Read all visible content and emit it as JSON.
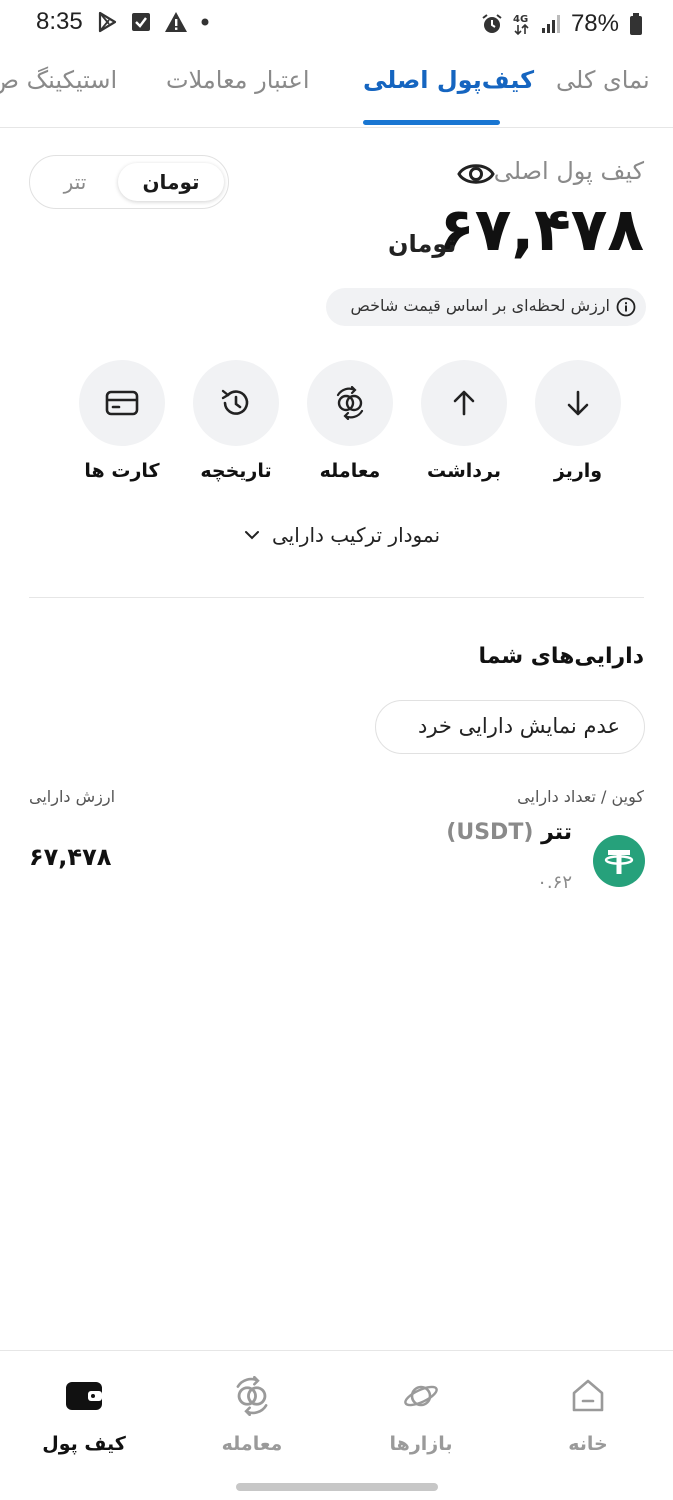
{
  "status_bar": {
    "time": "8:35",
    "battery": "78%",
    "icons": [
      "play-store-icon",
      "check-box-icon",
      "warning-icon",
      "dot-icon",
      "alarm-icon",
      "network-4g-icon",
      "signal-icon",
      "battery-icon"
    ]
  },
  "tabs": [
    {
      "label": "نمای کلی",
      "active": false
    },
    {
      "label": "کیف‌پول اصلی",
      "active": true
    },
    {
      "label": "اعتبار معاملات",
      "active": false
    },
    {
      "label": "استیکینگ ص",
      "active": false
    }
  ],
  "wallet": {
    "title": "کیف پول اصلی",
    "balance": "۶۷,۴۷۸",
    "unit": "تومان",
    "currency_toggle": {
      "selected": "تومان",
      "other": "تتر"
    },
    "info_note": "ارزش لحظه‌ای بر اساس قیمت شاخص"
  },
  "actions": [
    {
      "label": "واریز",
      "icon": "arrow-down-icon"
    },
    {
      "label": "برداشت",
      "icon": "arrow-up-icon"
    },
    {
      "label": "معامله",
      "icon": "exchange-icon"
    },
    {
      "label": "تاریخچه",
      "icon": "history-icon"
    },
    {
      "label": "کارت ها",
      "icon": "card-icon"
    }
  ],
  "chart_toggle": {
    "label": "نمودار ترکیب دارایی",
    "icon": "chevron-down-icon"
  },
  "assets": {
    "title": "دارایی‌های شما",
    "hide_small_label": "عدم نمایش دارایی خرد",
    "col_coin": "کوین / تعداد دارایی",
    "col_value": "ارزش دارایی",
    "items": [
      {
        "name": "تتر",
        "symbol": "(USDT)",
        "amount": "۰.۶۲",
        "value": "۶۷,۴۷۸",
        "icon": "tether-icon",
        "color": "#26a17b"
      }
    ]
  },
  "bottom_nav": [
    {
      "label": "خانه",
      "icon": "home-icon",
      "active": false
    },
    {
      "label": "بازارها",
      "icon": "planet-icon",
      "active": false
    },
    {
      "label": "معامله",
      "icon": "exchange-icon",
      "active": false
    },
    {
      "label": "کیف پول",
      "icon": "wallet-icon",
      "active": true
    }
  ],
  "colors": {
    "accent": "#1976d2",
    "tether": "#26a17b",
    "muted": "#8a8a8a"
  }
}
